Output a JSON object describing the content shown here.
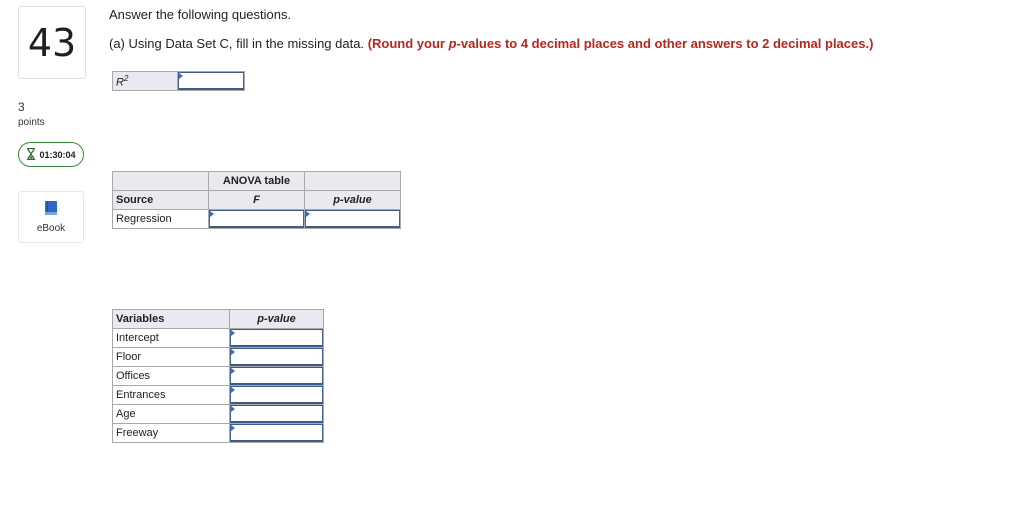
{
  "question": {
    "number": "43",
    "points_value": "3",
    "points_label": "points",
    "timer": "01:30:04",
    "ebook_label": "eBook"
  },
  "instructions": "Answer the following questions.",
  "part_a": {
    "prefix": "(a) Using Data Set C, fill in the missing data.",
    "hint_open": "(Round your ",
    "hint_p": "p",
    "hint_rest": "-values to 4 decimal places and other answers to 2 decimal places.)"
  },
  "r2": {
    "label_base": "R",
    "label_sup": "2",
    "value": ""
  },
  "anova": {
    "title": "ANOVA table",
    "headers": [
      "Source",
      "F",
      "p-value"
    ],
    "rows": [
      {
        "source": "Regression",
        "f": "",
        "p": ""
      }
    ]
  },
  "variables": {
    "headers": [
      "Variables",
      "p-value"
    ],
    "rows": [
      {
        "name": "Intercept",
        "p": ""
      },
      {
        "name": "Floor",
        "p": ""
      },
      {
        "name": "Offices",
        "p": ""
      },
      {
        "name": "Entrances",
        "p": ""
      },
      {
        "name": "Age",
        "p": ""
      },
      {
        "name": "Freeway",
        "p": ""
      }
    ]
  },
  "colors": {
    "hint_red": "#b4281f",
    "header_bg": "#e8eaf0",
    "input_border": "#3b5b89",
    "timer_border": "#3a8a3a"
  },
  "icons": [
    "hourglass-icon",
    "book-icon",
    "input-flag-icon"
  ]
}
